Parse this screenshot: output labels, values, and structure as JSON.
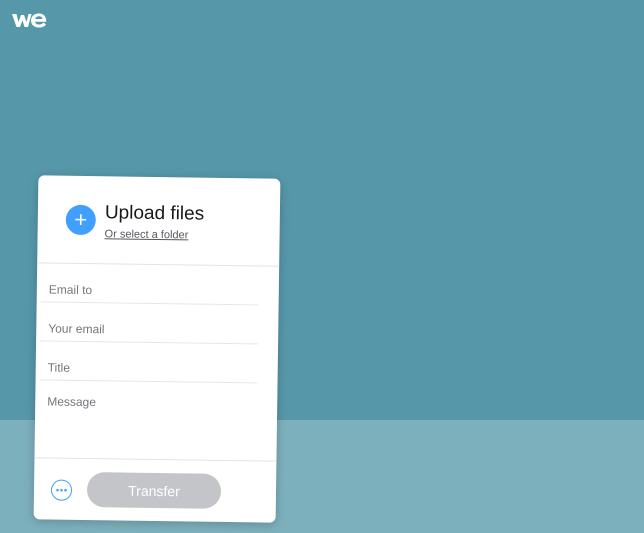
{
  "app": {
    "logo_icon": "wetransfer-logo"
  },
  "upload": {
    "title": "Upload files",
    "folder_link": "Or select a folder",
    "add_icon": "plus-icon"
  },
  "form": {
    "email_to_placeholder": "Email to",
    "your_email_placeholder": "Your email",
    "title_placeholder": "Title",
    "message_placeholder": "Message"
  },
  "footer": {
    "more_icon": "more-options-icon",
    "transfer_label": "Transfer"
  },
  "colors": {
    "background_top": "#5698aa",
    "background_bottom": "#7db0bd",
    "accent": "#409fff",
    "button_disabled": "#c4c5c9"
  }
}
